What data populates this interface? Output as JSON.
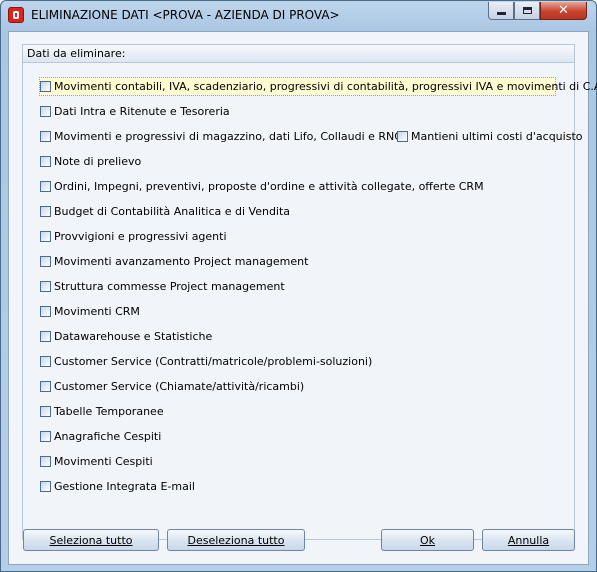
{
  "window": {
    "title": "ELIMINAZIONE DATI <PROVA - AZIENDA DI PROVA>",
    "minimize_label": "",
    "maximize_label": "",
    "close_label": "✕"
  },
  "group": {
    "title": "Dati da eliminare:"
  },
  "options": [
    {
      "label": "Movimenti contabili, IVA, scadenziario, progressivi di contabilità, progressivi IVA e movimenti di C.A.",
      "checked": false
    },
    {
      "label": "Dati Intra e Ritenute e Tesoreria",
      "checked": false
    },
    {
      "label": "Movimenti  e progressivi di magazzino, dati Lifo, Collaudi e RNC",
      "checked": false
    },
    {
      "label": "Note di prelievo",
      "checked": false
    },
    {
      "label": "Ordini, Impegni, preventivi, proposte d'ordine e attività collegate, offerte CRM",
      "checked": false
    },
    {
      "label": "Budget di Contabilità Analitica e di Vendita",
      "checked": false
    },
    {
      "label": "Provvigioni e progressivi agenti",
      "checked": false
    },
    {
      "label": "Movimenti avanzamento Project management",
      "checked": false
    },
    {
      "label": "Struttura commesse Project management",
      "checked": false
    },
    {
      "label": "Movimenti CRM",
      "checked": false
    },
    {
      "label": "Datawarehouse e Statistiche",
      "checked": false
    },
    {
      "label": "Customer Service (Contratti/matricole/problemi-soluzioni)",
      "checked": false
    },
    {
      "label": "Customer Service (Chiamate/attività/ricambi)",
      "checked": false
    },
    {
      "label": "Tabelle Temporanee",
      "checked": false
    },
    {
      "label": "Anagrafiche Cespiti",
      "checked": false
    },
    {
      "label": "Movimenti Cespiti",
      "checked": false
    },
    {
      "label": "Gestione Integrata E-mail",
      "checked": false
    }
  ],
  "extra_option": {
    "label": "Mantieni ultimi costi d'acquisto",
    "checked": false
  },
  "buttons": {
    "select_all": "Seleziona tutto",
    "deselect_all": "Deseleziona tutto",
    "ok": "Ok",
    "cancel": "Annulla"
  }
}
